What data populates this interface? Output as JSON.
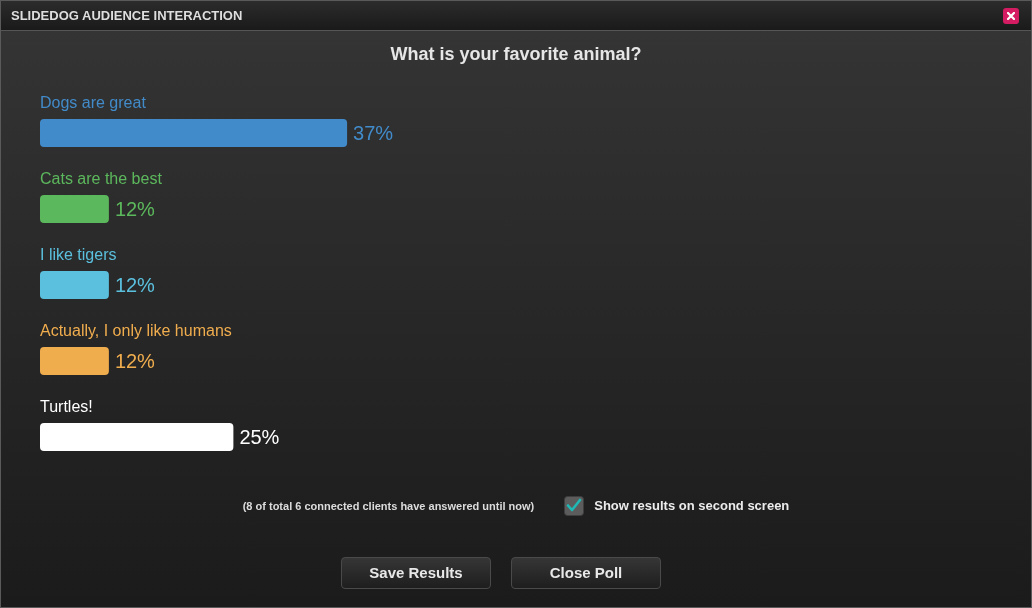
{
  "window": {
    "title": "SLIDEDOG AUDIENCE INTERACTION"
  },
  "poll": {
    "question": "What is your favorite animal?",
    "options": [
      {
        "label": "Dogs are great",
        "level": 0.37,
        "reading": "37%",
        "color": "#428bca"
      },
      {
        "label": "Cats are the best",
        "level": 0.083,
        "reading": "12%",
        "color": "#5cb85c"
      },
      {
        "label": "I like tigers",
        "level": 0.083,
        "reading": "12%",
        "color": "#5bc0de"
      },
      {
        "label": "Actually, I only like humans",
        "level": 0.083,
        "reading": "12%",
        "color": "#f0ad4e"
      },
      {
        "label": "Turtles!",
        "level": 0.233,
        "reading": "25%",
        "color": "#ffffff"
      }
    ]
  },
  "footer": {
    "note": "(8 of total 6 connected clients have answered until now)",
    "second_screen": {
      "label": "Show results on second screen",
      "checked": true
    }
  },
  "buttons": [
    {
      "label": "Save Results"
    },
    {
      "label": "Close Poll"
    }
  ]
}
